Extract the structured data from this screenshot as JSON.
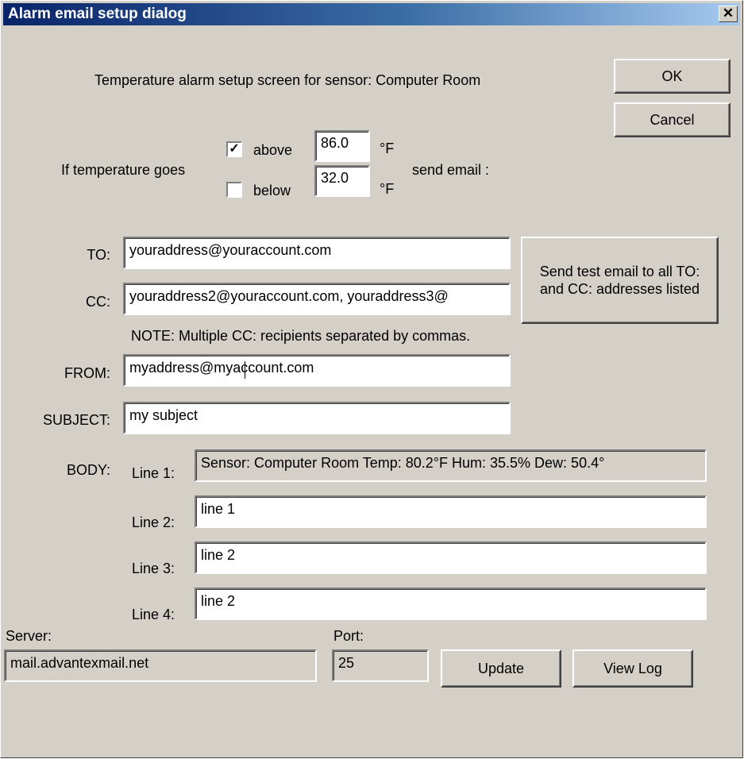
{
  "window": {
    "title": "Alarm email setup dialog",
    "close_glyph": "✕"
  },
  "header": {
    "text": "Temperature alarm setup screen for sensor: Computer Room"
  },
  "buttons": {
    "ok": "OK",
    "cancel": "Cancel",
    "test_email": "Send test email to all TO: and CC: addresses listed",
    "update": "Update",
    "view_log": "View Log"
  },
  "condition": {
    "prefix": "If temperature goes",
    "above": {
      "label": "above",
      "checked": true,
      "value": "86.0",
      "unit": "°F"
    },
    "below": {
      "label": "below",
      "checked": false,
      "value": "32.0",
      "unit": "°F"
    },
    "suffix": "send email :"
  },
  "email": {
    "to_label": "TO:",
    "to_value": "youraddress@youraccount.com",
    "cc_label": "CC:",
    "cc_value": "youraddress2@youraccount.com, youraddress3@",
    "note": "NOTE: Multiple CC: recipients separated by commas.",
    "from_label": "FROM:",
    "from_value": "myaddress@myaccount.com",
    "subject_label": "SUBJECT:",
    "subject_value": "my subject"
  },
  "body": {
    "label": "BODY:",
    "lines": [
      {
        "label": "Line 1:",
        "value": "Sensor: Computer Room   Temp: 80.2°F  Hum: 35.5%  Dew: 50.4°",
        "readonly": true
      },
      {
        "label": "Line 2:",
        "value": "line 1",
        "readonly": false
      },
      {
        "label": "Line 3:",
        "value": "line 2",
        "readonly": false
      },
      {
        "label": "Line 4:",
        "value": "line 2",
        "readonly": false
      }
    ]
  },
  "server": {
    "label": "Server:",
    "value": "mail.advantexmail.net",
    "port_label": "Port:",
    "port_value": "25"
  }
}
